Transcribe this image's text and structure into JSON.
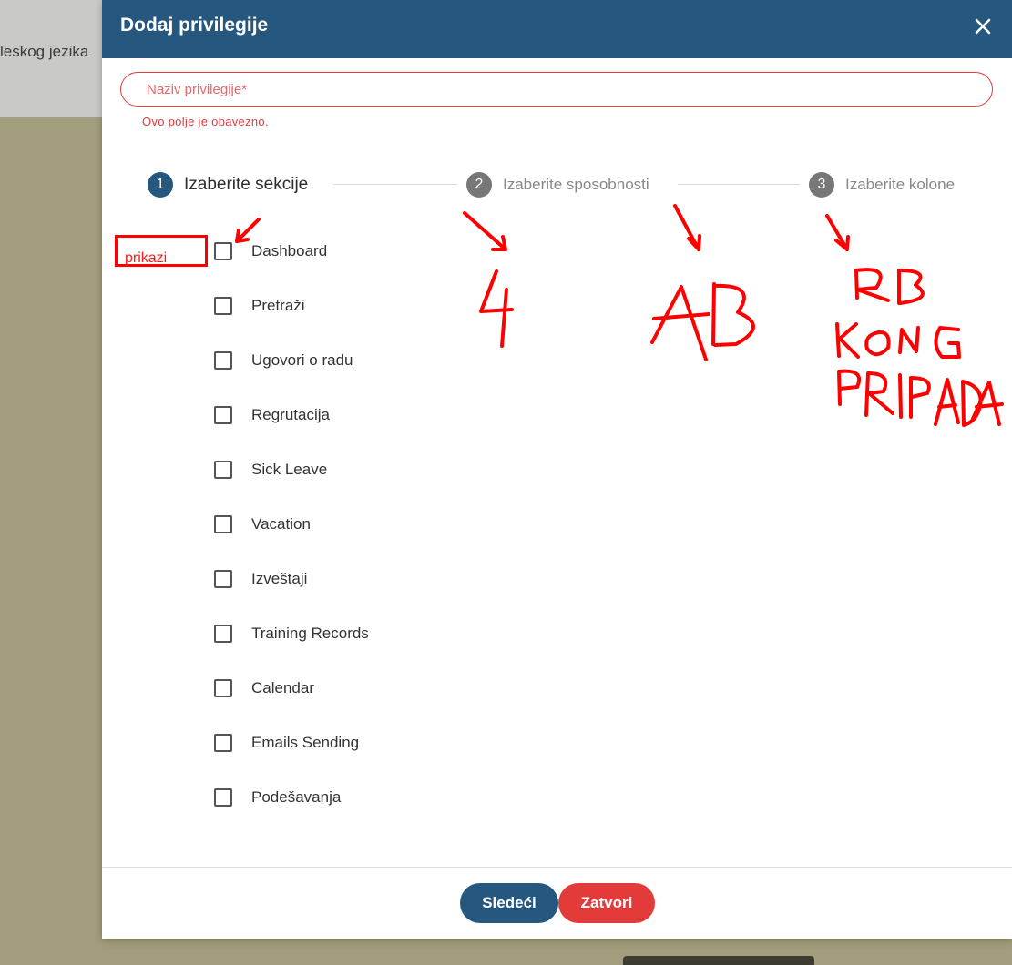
{
  "background": {
    "partial_text": "leskog jezika"
  },
  "modal": {
    "title": "Dodaj privilegije",
    "close_icon": "close-icon",
    "name_field": {
      "placeholder": "Naziv privilegije*",
      "value": "",
      "error": "Ovo polje je obavezno."
    },
    "steps": [
      {
        "number": "1",
        "label": "Izaberite sekcije",
        "active": true
      },
      {
        "number": "2",
        "label": "Izaberite sposobnosti",
        "active": false
      },
      {
        "number": "3",
        "label": "Izaberite kolone",
        "active": false
      }
    ],
    "sections": [
      {
        "label": "Dashboard",
        "checked": false
      },
      {
        "label": "Pretraži",
        "checked": false
      },
      {
        "label": "Ugovori o radu",
        "checked": false
      },
      {
        "label": "Regrutacija",
        "checked": false
      },
      {
        "label": "Sick Leave",
        "checked": false
      },
      {
        "label": "Vacation",
        "checked": false
      },
      {
        "label": "Izveštaji",
        "checked": false
      },
      {
        "label": "Training Records",
        "checked": false
      },
      {
        "label": "Calendar",
        "checked": false
      },
      {
        "label": "Emails Sending",
        "checked": false
      },
      {
        "label": "Podešavanja",
        "checked": false
      }
    ],
    "buttons": {
      "next": "Sledeći",
      "close": "Zatvori"
    }
  },
  "annotations": {
    "box_label": "prikazi",
    "color": "#ff0000"
  },
  "colors": {
    "header": "#26587f",
    "error": "#e43b3b",
    "next_button": "#26587f",
    "close_button": "#e33b3a",
    "backdrop": "#a29d7c"
  }
}
